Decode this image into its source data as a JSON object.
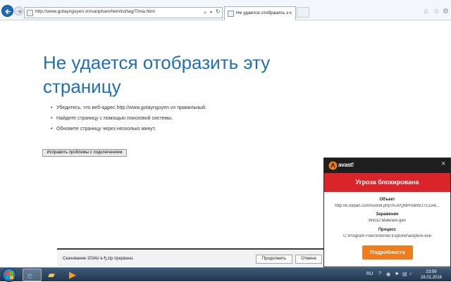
{
  "browser": {
    "url": "http://www.gotaynguyen.vn/sanpham/itemlist/tag/Ttma.html",
    "tab_label": "Не удается отобразить эту..."
  },
  "error_page": {
    "title": "Не удается отобразить эту страницу",
    "tips": [
      "Убедитесь, что веб-адрес http://www.gotaynguyen.vn правильный.",
      "Найдите страницу с помощью поисковой системы.",
      "Обновите страницу через несколько минут."
    ],
    "fix_button": "Исправить проблемы с подключением"
  },
  "download_bar": {
    "message": "Скачивание 2034э`е-ђ.zip прервано.",
    "open_label": "Продолжить",
    "cancel_label": "Отмена"
  },
  "avast": {
    "brand": "avast!",
    "banner": "Угроза блокирована",
    "object_label": "Объект",
    "object_value": "http://k.u9pan.com/sub/dl.php?AJVQNP0xBWJTC1A6...",
    "infection_label": "Заражение",
    "infection_value": "Win32:Malware-gen",
    "process_label": "Процесс",
    "process_value": "C:\\Program Files\\Internet Explorer\\iexplore.exe",
    "details_button": "Подробности"
  },
  "taskbar": {
    "language": "RU",
    "time": "23:59",
    "date": "28.01.2016"
  },
  "colors": {
    "title_blue": "#1e6fb8",
    "avast_red": "#d9252a",
    "avast_orange": "#f07c1d"
  }
}
